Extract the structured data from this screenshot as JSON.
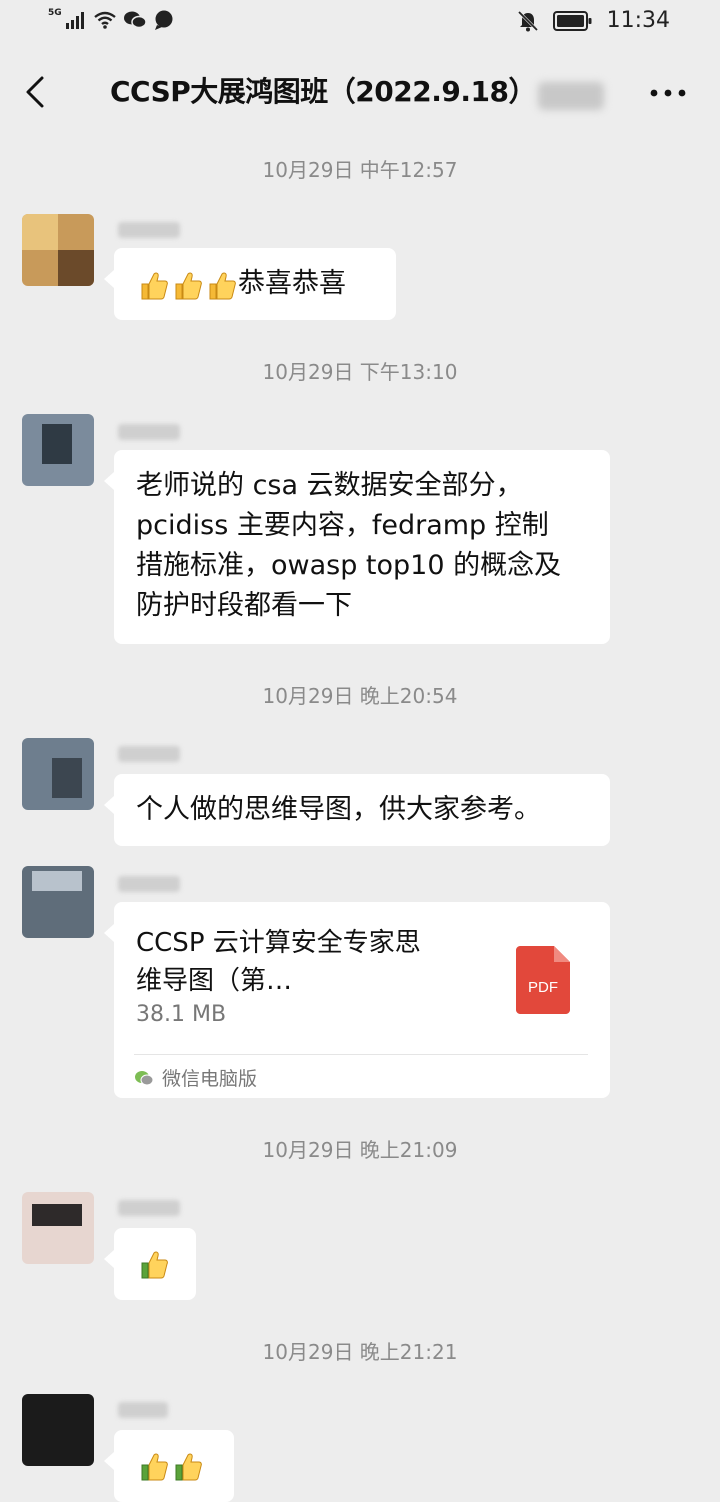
{
  "status": {
    "network": "5G",
    "time": "11:34"
  },
  "header": {
    "title": "CCSP大展鸿图班（2022.9.18）",
    "back_icon": "chevron-left-icon",
    "more_icon": "more-dots-icon"
  },
  "messages": [
    {
      "timestamp": "10月29日 中午12:57",
      "text": "恭喜恭喜",
      "thumbs": 3
    },
    {
      "timestamp": "10月29日 下午13:10",
      "lines": [
        "老师说的 csa 云数据安全部分，",
        "pcidiss 主要内容，fedramp 控制",
        "措施标准，owasp top10 的概念及",
        "防护时段都看一下"
      ]
    },
    {
      "timestamp": "10月29日 晚上20:54",
      "text": "个人做的思维导图，供大家参考。"
    },
    {
      "file": {
        "title_line1": "CCSP 云计算安全专家思",
        "title_line2": "维导图（第…",
        "size": "38.1 MB",
        "icon_label": "PDF",
        "source": "微信电脑版"
      }
    },
    {
      "timestamp": "10月29日 晚上21:09",
      "thumbs": 1
    },
    {
      "timestamp": "10月29日 晚上21:21",
      "thumbs": 2
    }
  ],
  "colors": {
    "background": "#ededed",
    "bubble": "#ffffff",
    "pdf": "#e2483b"
  }
}
